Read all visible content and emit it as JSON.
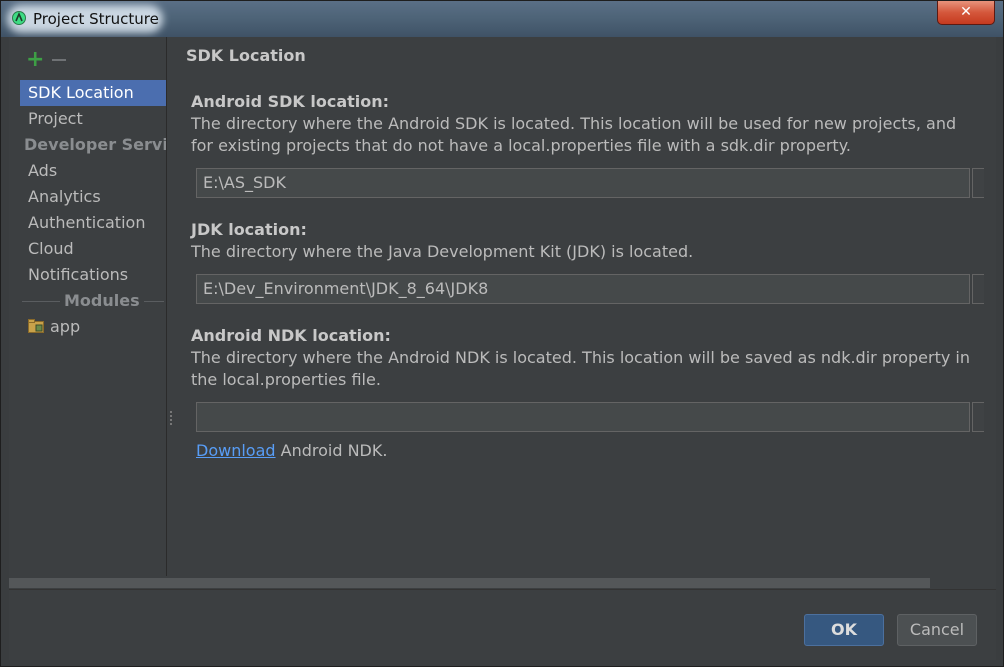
{
  "window": {
    "title": "Project Structure",
    "close_glyph": "✕",
    "icon": "android-studio-icon"
  },
  "toolbar": {
    "add_glyph": "+",
    "add_icon": "add-icon",
    "remove_icon": "remove-icon"
  },
  "sidebar": {
    "items": [
      {
        "label": "SDK Location",
        "selected": true
      },
      {
        "label": "Project",
        "selected": false
      }
    ],
    "developer_services_header": "Developer Services",
    "developer_services": [
      "Ads",
      "Analytics",
      "Authentication",
      "Cloud",
      "Notifications"
    ],
    "modules_header": "Modules",
    "modules": [
      {
        "label": "app",
        "icon": "module-folder-icon"
      }
    ]
  },
  "panel": {
    "title": "SDK Location",
    "android_sdk": {
      "label": "Android SDK location:",
      "description": "The directory where the Android SDK is located. This location will be used for new projects, and for existing projects that do not have a local.properties file with a sdk.dir property.",
      "value": "E:\\AS_SDK"
    },
    "jdk": {
      "label": "JDK location:",
      "description": "The directory where the Java Development Kit (JDK) is located.",
      "value": "E:\\Dev_Environment\\JDK_8_64\\JDK8"
    },
    "android_ndk": {
      "label": "Android NDK location:",
      "description": "The directory where the Android NDK is located. This location will be saved as ndk.dir property in the local.properties file.",
      "value": "",
      "download_link": "Download",
      "download_suffix": " Android NDK."
    }
  },
  "buttons": {
    "ok": "OK",
    "cancel": "Cancel"
  },
  "colors": {
    "background": "#3c3f41",
    "selection": "#4b6eaf",
    "link": "#589df6",
    "add_icon": "#3d9f45",
    "ok_button": "#365880"
  }
}
